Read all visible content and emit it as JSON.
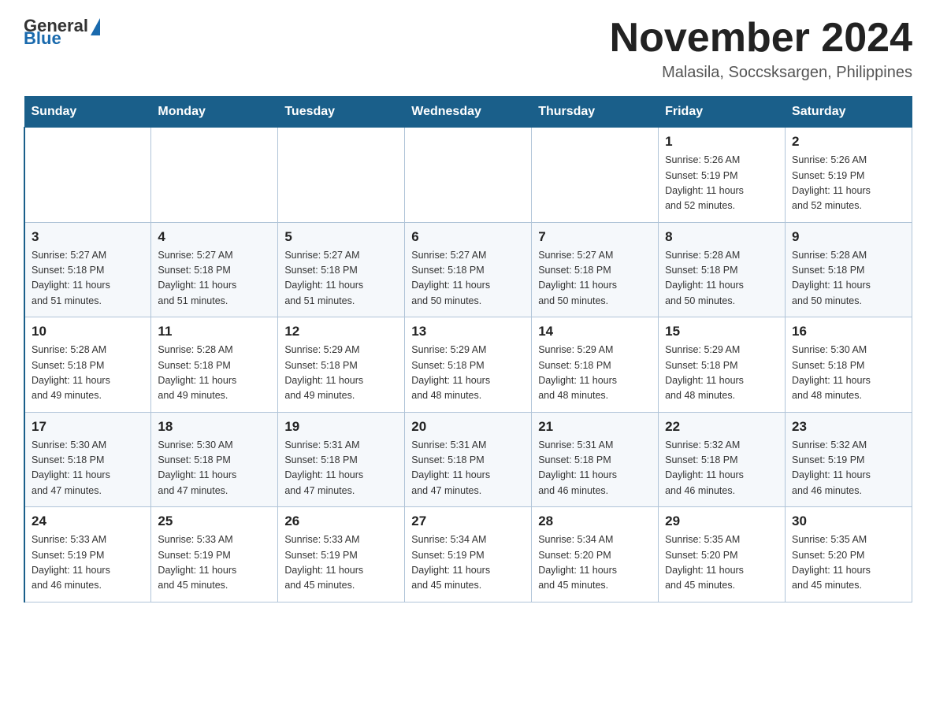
{
  "header": {
    "logo_general": "General",
    "logo_blue": "Blue",
    "title": "November 2024",
    "subtitle": "Malasila, Soccsksargen, Philippines"
  },
  "days_of_week": [
    "Sunday",
    "Monday",
    "Tuesday",
    "Wednesday",
    "Thursday",
    "Friday",
    "Saturday"
  ],
  "weeks": [
    [
      {
        "day": "",
        "info": ""
      },
      {
        "day": "",
        "info": ""
      },
      {
        "day": "",
        "info": ""
      },
      {
        "day": "",
        "info": ""
      },
      {
        "day": "",
        "info": ""
      },
      {
        "day": "1",
        "info": "Sunrise: 5:26 AM\nSunset: 5:19 PM\nDaylight: 11 hours\nand 52 minutes."
      },
      {
        "day": "2",
        "info": "Sunrise: 5:26 AM\nSunset: 5:19 PM\nDaylight: 11 hours\nand 52 minutes."
      }
    ],
    [
      {
        "day": "3",
        "info": "Sunrise: 5:27 AM\nSunset: 5:18 PM\nDaylight: 11 hours\nand 51 minutes."
      },
      {
        "day": "4",
        "info": "Sunrise: 5:27 AM\nSunset: 5:18 PM\nDaylight: 11 hours\nand 51 minutes."
      },
      {
        "day": "5",
        "info": "Sunrise: 5:27 AM\nSunset: 5:18 PM\nDaylight: 11 hours\nand 51 minutes."
      },
      {
        "day": "6",
        "info": "Sunrise: 5:27 AM\nSunset: 5:18 PM\nDaylight: 11 hours\nand 50 minutes."
      },
      {
        "day": "7",
        "info": "Sunrise: 5:27 AM\nSunset: 5:18 PM\nDaylight: 11 hours\nand 50 minutes."
      },
      {
        "day": "8",
        "info": "Sunrise: 5:28 AM\nSunset: 5:18 PM\nDaylight: 11 hours\nand 50 minutes."
      },
      {
        "day": "9",
        "info": "Sunrise: 5:28 AM\nSunset: 5:18 PM\nDaylight: 11 hours\nand 50 minutes."
      }
    ],
    [
      {
        "day": "10",
        "info": "Sunrise: 5:28 AM\nSunset: 5:18 PM\nDaylight: 11 hours\nand 49 minutes."
      },
      {
        "day": "11",
        "info": "Sunrise: 5:28 AM\nSunset: 5:18 PM\nDaylight: 11 hours\nand 49 minutes."
      },
      {
        "day": "12",
        "info": "Sunrise: 5:29 AM\nSunset: 5:18 PM\nDaylight: 11 hours\nand 49 minutes."
      },
      {
        "day": "13",
        "info": "Sunrise: 5:29 AM\nSunset: 5:18 PM\nDaylight: 11 hours\nand 48 minutes."
      },
      {
        "day": "14",
        "info": "Sunrise: 5:29 AM\nSunset: 5:18 PM\nDaylight: 11 hours\nand 48 minutes."
      },
      {
        "day": "15",
        "info": "Sunrise: 5:29 AM\nSunset: 5:18 PM\nDaylight: 11 hours\nand 48 minutes."
      },
      {
        "day": "16",
        "info": "Sunrise: 5:30 AM\nSunset: 5:18 PM\nDaylight: 11 hours\nand 48 minutes."
      }
    ],
    [
      {
        "day": "17",
        "info": "Sunrise: 5:30 AM\nSunset: 5:18 PM\nDaylight: 11 hours\nand 47 minutes."
      },
      {
        "day": "18",
        "info": "Sunrise: 5:30 AM\nSunset: 5:18 PM\nDaylight: 11 hours\nand 47 minutes."
      },
      {
        "day": "19",
        "info": "Sunrise: 5:31 AM\nSunset: 5:18 PM\nDaylight: 11 hours\nand 47 minutes."
      },
      {
        "day": "20",
        "info": "Sunrise: 5:31 AM\nSunset: 5:18 PM\nDaylight: 11 hours\nand 47 minutes."
      },
      {
        "day": "21",
        "info": "Sunrise: 5:31 AM\nSunset: 5:18 PM\nDaylight: 11 hours\nand 46 minutes."
      },
      {
        "day": "22",
        "info": "Sunrise: 5:32 AM\nSunset: 5:18 PM\nDaylight: 11 hours\nand 46 minutes."
      },
      {
        "day": "23",
        "info": "Sunrise: 5:32 AM\nSunset: 5:19 PM\nDaylight: 11 hours\nand 46 minutes."
      }
    ],
    [
      {
        "day": "24",
        "info": "Sunrise: 5:33 AM\nSunset: 5:19 PM\nDaylight: 11 hours\nand 46 minutes."
      },
      {
        "day": "25",
        "info": "Sunrise: 5:33 AM\nSunset: 5:19 PM\nDaylight: 11 hours\nand 45 minutes."
      },
      {
        "day": "26",
        "info": "Sunrise: 5:33 AM\nSunset: 5:19 PM\nDaylight: 11 hours\nand 45 minutes."
      },
      {
        "day": "27",
        "info": "Sunrise: 5:34 AM\nSunset: 5:19 PM\nDaylight: 11 hours\nand 45 minutes."
      },
      {
        "day": "28",
        "info": "Sunrise: 5:34 AM\nSunset: 5:20 PM\nDaylight: 11 hours\nand 45 minutes."
      },
      {
        "day": "29",
        "info": "Sunrise: 5:35 AM\nSunset: 5:20 PM\nDaylight: 11 hours\nand 45 minutes."
      },
      {
        "day": "30",
        "info": "Sunrise: 5:35 AM\nSunset: 5:20 PM\nDaylight: 11 hours\nand 45 minutes."
      }
    ]
  ]
}
